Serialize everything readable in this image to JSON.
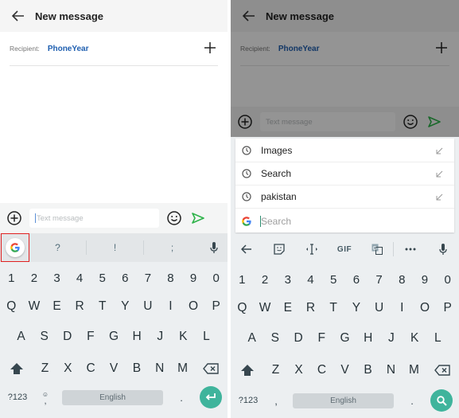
{
  "left": {
    "header": {
      "title": "New message",
      "back_icon": "arrow-left-icon"
    },
    "recipient": {
      "label": "Recipient:",
      "name": "PhoneYear",
      "add_icon": "plus-icon"
    },
    "compose": {
      "placeholder": "Text message",
      "attach_icon": "plus-circle-icon",
      "emoji_icon": "smiley-icon",
      "send_icon": "send-icon"
    },
    "suggestions": {
      "google_icon": "google-g-icon",
      "items": [
        "?",
        "!",
        ";"
      ],
      "mic_icon": "microphone-icon"
    },
    "keyboard": {
      "numbers": [
        "1",
        "2",
        "3",
        "4",
        "5",
        "6",
        "7",
        "8",
        "9",
        "0"
      ],
      "row1": [
        "Q",
        "W",
        "E",
        "R",
        "T",
        "Y",
        "U",
        "I",
        "O",
        "P"
      ],
      "row2": [
        "A",
        "S",
        "D",
        "F",
        "G",
        "H",
        "J",
        "K",
        "L"
      ],
      "row3": [
        "Z",
        "X",
        "C",
        "V",
        "B",
        "N",
        "M"
      ],
      "symbols_key": "?123",
      "comma_key": ",",
      "space_label": "English",
      "period_key": ".",
      "enter_icon": "enter-icon"
    }
  },
  "right": {
    "header": {
      "title": "New message"
    },
    "recipient": {
      "label": "Recipient:",
      "name": "PhoneYear"
    },
    "compose": {
      "placeholder": "Text message"
    },
    "search": {
      "history": [
        {
          "text": "Images"
        },
        {
          "text": "Search"
        },
        {
          "text": "pakistan"
        }
      ],
      "placeholder": "Search"
    },
    "toolbar": {
      "gif_label": "GIF"
    },
    "keyboard": {
      "numbers": [
        "1",
        "2",
        "3",
        "4",
        "5",
        "6",
        "7",
        "8",
        "9",
        "0"
      ],
      "row1": [
        "Q",
        "W",
        "E",
        "R",
        "T",
        "Y",
        "U",
        "I",
        "O",
        "P"
      ],
      "row2": [
        "A",
        "S",
        "D",
        "F",
        "G",
        "H",
        "J",
        "K",
        "L"
      ],
      "row3": [
        "Z",
        "X",
        "C",
        "V",
        "B",
        "N",
        "M"
      ],
      "symbols_key": "?123",
      "comma_key": ",",
      "space_label": "English",
      "period_key": ".",
      "enter_icon": "search-icon"
    }
  },
  "colors": {
    "accent_green": "#3fb49c",
    "send_green": "#2eb34a",
    "recipient_blue": "#1f5fb0",
    "highlight_red": "#e02020"
  }
}
